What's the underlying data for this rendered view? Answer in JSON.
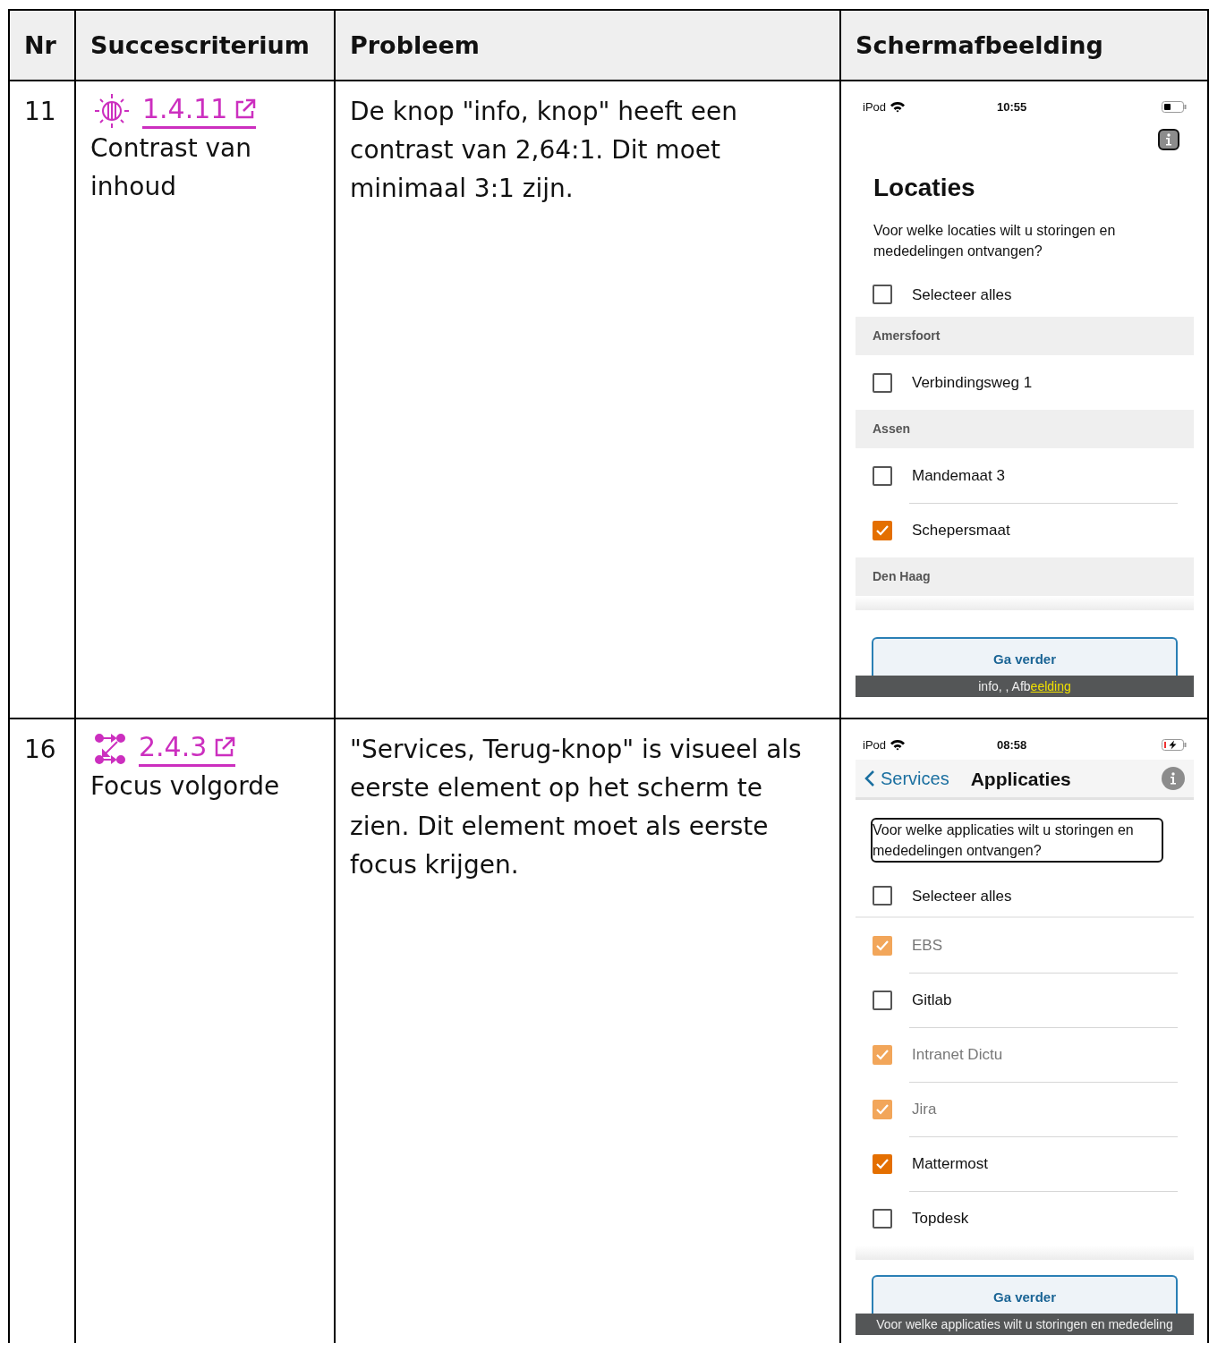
{
  "table": {
    "columns": [
      "Nr",
      "Succescriterium",
      "Probleem",
      "Schermafbeelding"
    ],
    "rows": [
      {
        "nr": "11",
        "criterion": {
          "code": "1.4.11",
          "name": "Contrast van inhoud"
        },
        "problem": "De knop \"info, knop\" heeft een contrast van 2,64:1. Dit moet minimaal 3:1 zijn.",
        "screenshot": {
          "status": {
            "carrier": "iPod",
            "time": "10:55",
            "charging": false
          },
          "info_button": {
            "focused": true
          },
          "heading": "Locaties",
          "question": {
            "text": "Voor welke locaties wilt u storingen en mededelingen ontvangen?",
            "focused": false
          },
          "items": [
            {
              "kind": "checkbox",
              "label": "Selecteer alles",
              "checked": false,
              "disabled": false
            },
            {
              "kind": "section",
              "label": "Amersfoort"
            },
            {
              "kind": "checkbox",
              "label": "Verbindingsweg 1",
              "checked": false,
              "disabled": false
            },
            {
              "kind": "section",
              "label": "Assen"
            },
            {
              "kind": "checkbox",
              "label": "Mandemaat 3",
              "checked": false,
              "disabled": false
            },
            {
              "kind": "checkbox",
              "label": "Schepersmaat",
              "checked": true,
              "disabled": false
            },
            {
              "kind": "section",
              "label": "Den Haag"
            }
          ],
          "button": "Ga verder",
          "caption": {
            "text": "info,  , Afb",
            "highlight": "eelding"
          }
        }
      },
      {
        "nr": "16",
        "criterion": {
          "code": "2.4.3",
          "name": "Focus volgorde"
        },
        "problem": "\"Services, Terug-knop\" is visueel als eerste element op het scherm te zien. Dit element moet als eerste focus krijgen.",
        "screenshot": {
          "status": {
            "carrier": "iPod",
            "time": "08:58",
            "charging": true
          },
          "nav": {
            "back": "Services",
            "title": "Applicaties"
          },
          "info_button": {
            "focused": false
          },
          "question": {
            "text": "Voor welke applicaties wilt u storingen en mededelingen ontvangen?",
            "focused": true
          },
          "items": [
            {
              "kind": "checkbox",
              "label": "Selecteer alles",
              "checked": false,
              "disabled": false
            },
            {
              "kind": "checkbox",
              "label": "EBS",
              "checked": true,
              "disabled": true
            },
            {
              "kind": "checkbox",
              "label": "Gitlab",
              "checked": false,
              "disabled": false
            },
            {
              "kind": "checkbox",
              "label": "Intranet Dictu",
              "checked": true,
              "disabled": true
            },
            {
              "kind": "checkbox",
              "label": "Jira",
              "checked": true,
              "disabled": true
            },
            {
              "kind": "checkbox",
              "label": "Mattermost",
              "checked": true,
              "disabled": false
            },
            {
              "kind": "checkbox",
              "label": "Topdesk",
              "checked": false,
              "disabled": false
            }
          ],
          "button": "Ga verder",
          "caption": {
            "text": "Voor welke applicaties wilt u storingen en mededeling"
          }
        }
      }
    ]
  }
}
